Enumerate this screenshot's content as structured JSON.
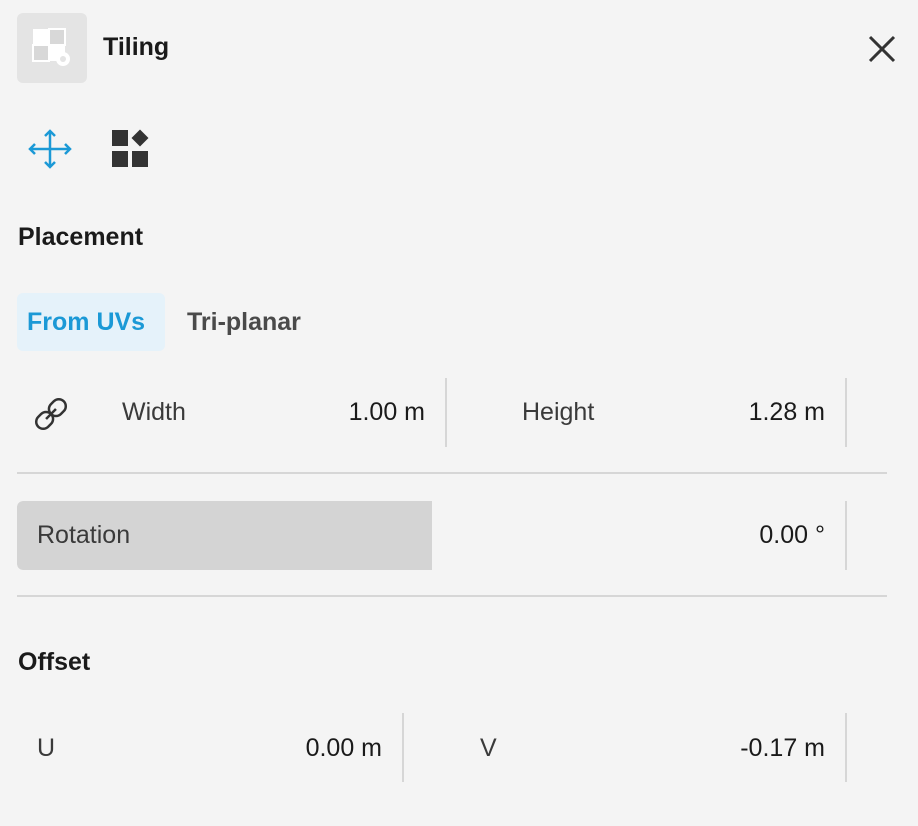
{
  "header": {
    "title": "Tiling",
    "app_icon": "tiling-settings-icon",
    "close_icon": "close-icon"
  },
  "mode_toolbar": {
    "items": [
      {
        "icon": "move-arrows-icon",
        "active": true,
        "color": "#1b99d6"
      },
      {
        "icon": "tile-shapes-icon",
        "active": false,
        "color": "#333333"
      }
    ]
  },
  "placement": {
    "label": "Placement",
    "tabs": [
      {
        "label": "From UVs",
        "active": true
      },
      {
        "label": "Tri-planar",
        "active": false
      }
    ],
    "link_icon": "link-icon",
    "width": {
      "label": "Width",
      "value": "1.00 m"
    },
    "height": {
      "label": "Height",
      "value": "1.28 m"
    },
    "rotation": {
      "label": "Rotation",
      "value": "0.00 °",
      "fill_fraction": 0.5
    }
  },
  "offset": {
    "label": "Offset",
    "u": {
      "label": "U",
      "value": "0.00 m"
    },
    "v": {
      "label": "V",
      "value": "-0.17 m"
    }
  },
  "colors": {
    "accent": "#1b99d6",
    "accent_bg": "#e5f2fa",
    "panel_bg": "#f4f4f4",
    "slider_fill": "#d4d4d4"
  }
}
